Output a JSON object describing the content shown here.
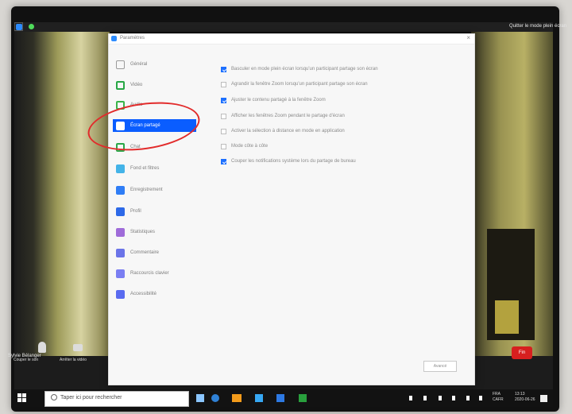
{
  "zoom": {
    "window_title": "Paramètres",
    "exit_fullscreen": "Quitter le mode plein écran",
    "participant_name": "Sylvie Bélanger",
    "toolbar": {
      "mute_label": "Couper le son",
      "video_label": "Arrêter la vidéo",
      "end_label": "Fin"
    }
  },
  "sidebar": {
    "items": [
      {
        "label": "Général",
        "icon": "settings-icon",
        "color": "#9a9a9a"
      },
      {
        "label": "Vidéo",
        "icon": "video-icon",
        "color": "#28a745"
      },
      {
        "label": "Audio",
        "icon": "audio-icon",
        "color": "#39b54a"
      },
      {
        "label": "Écran partagé",
        "icon": "share-screen-icon",
        "color": "#ffffff",
        "active": true
      },
      {
        "label": "Chat",
        "icon": "chat-icon",
        "color": "#2ba84a"
      },
      {
        "label": "Fond et filtres",
        "icon": "background-filter-icon",
        "color": "#43b3e8"
      },
      {
        "label": "Enregistrement",
        "icon": "record-icon",
        "color": "#2f7df6"
      },
      {
        "label": "Profil",
        "icon": "profile-icon",
        "color": "#2d69e8"
      },
      {
        "label": "Statistiques",
        "icon": "statistics-icon",
        "color": "#9f6cd9"
      },
      {
        "label": "Commentaire",
        "icon": "feedback-icon",
        "color": "#6b74e8"
      },
      {
        "label": "Raccourcis clavier",
        "icon": "keyboard-shortcuts-icon",
        "color": "#7a7ef2"
      },
      {
        "label": "Accessibilité",
        "icon": "accessibility-icon",
        "color": "#5a6bf0"
      }
    ]
  },
  "main": {
    "options": [
      {
        "label": "Basculer en mode plein écran lorsqu'un participant partage son écran",
        "checked": true
      },
      {
        "label": "Agrandir la fenêtre Zoom lorsqu'un participant partage son écran",
        "checked": false
      },
      {
        "label": "Ajuster le contenu partagé à la fenêtre Zoom",
        "checked": true
      },
      {
        "label": "Afficher les fenêtres Zoom pendant le partage d'écran",
        "checked": false
      },
      {
        "label": "Activer la sélection à distance en mode en application",
        "checked": false
      },
      {
        "label": "Mode côte à côte",
        "checked": false
      },
      {
        "label": "Couper les notifications système lors du partage de bureau",
        "checked": true
      }
    ],
    "advanced_label": "Avancé"
  },
  "taskbar": {
    "search_placeholder": "Taper ici pour rechercher",
    "language": "FRA\nCAFR",
    "time": "13:13\n2020-06-26"
  }
}
